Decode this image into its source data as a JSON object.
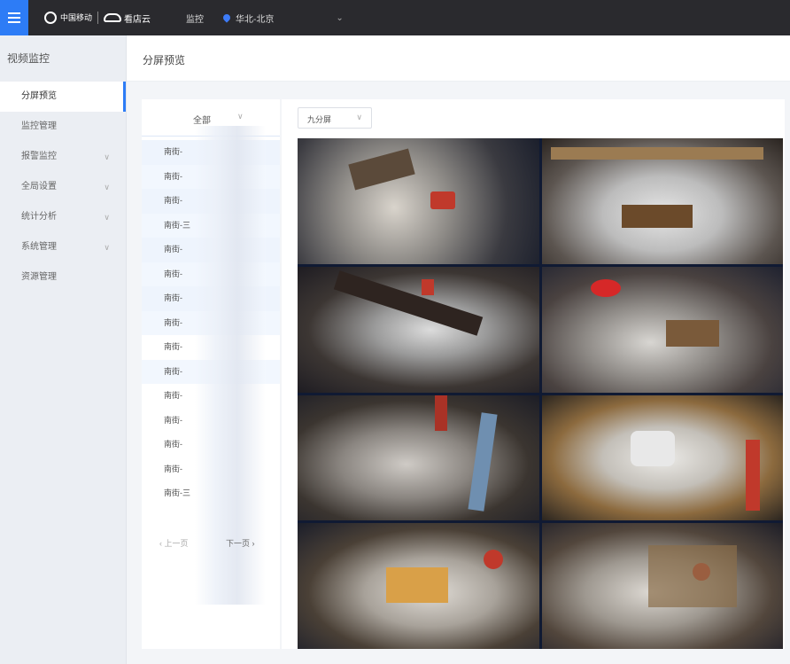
{
  "topbar": {
    "brand_text": "中国移动",
    "cloud_text": "看店云",
    "link": "监控",
    "location": "华北-北京"
  },
  "sidebar": {
    "title": "视频监控",
    "items": [
      {
        "label": "分屏预览",
        "active": true,
        "chevron": false
      },
      {
        "label": "监控管理",
        "active": false,
        "chevron": false
      },
      {
        "label": "报警监控",
        "active": false,
        "chevron": true
      },
      {
        "label": "全局设置",
        "active": false,
        "chevron": true
      },
      {
        "label": "统计分析",
        "active": false,
        "chevron": true
      },
      {
        "label": "系统管理",
        "active": false,
        "chevron": true
      },
      {
        "label": "资源管理",
        "active": false,
        "chevron": false
      }
    ]
  },
  "page": {
    "title": "分屏预览"
  },
  "device_panel": {
    "filter_label": "全部",
    "devices": [
      "南街-",
      "南街-",
      "南街-",
      "南街-三",
      "南街-",
      "南街-",
      "南街-",
      "南街-",
      "南街-",
      "南街-",
      "南街-",
      "南街-",
      "南街-",
      "南街-",
      "南街-三"
    ],
    "prev_label": "‹ 上一页",
    "next_label": "下一页 ›"
  },
  "video_panel": {
    "layout_label": "九分屏"
  }
}
